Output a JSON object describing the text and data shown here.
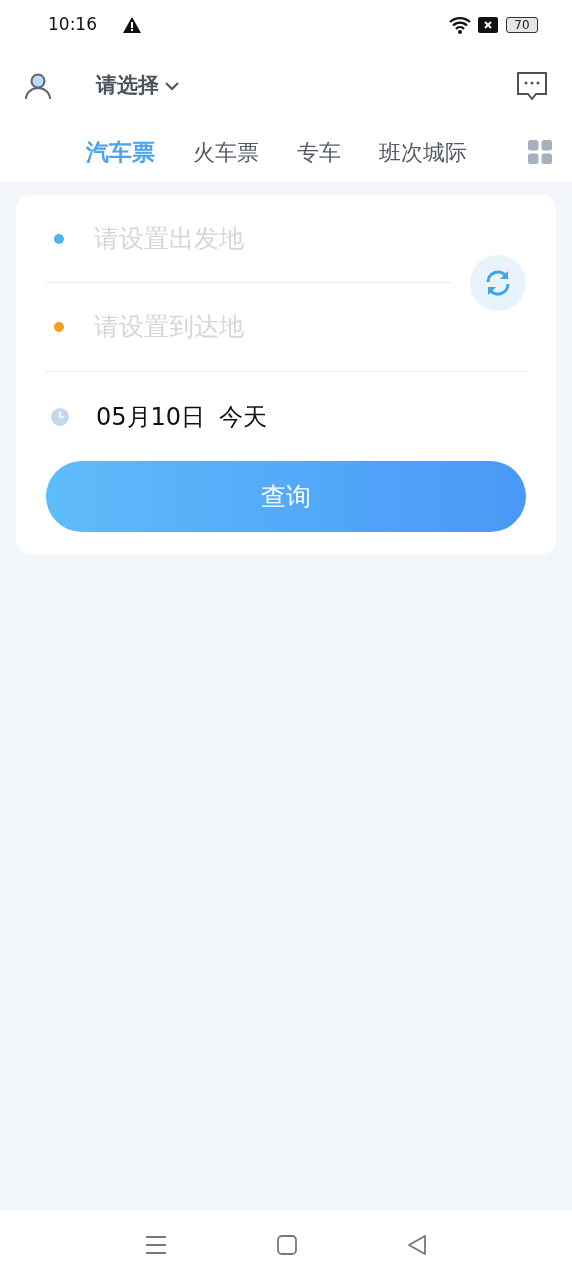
{
  "status_bar": {
    "time": "10:16",
    "battery": "70"
  },
  "header": {
    "city_picker": "请选择"
  },
  "tabs": [
    {
      "label": "汽车票",
      "selected": true
    },
    {
      "label": "火车票",
      "selected": false
    },
    {
      "label": "专车",
      "selected": false
    },
    {
      "label": "班次城际",
      "selected": false
    }
  ],
  "search": {
    "origin": {
      "placeholder": "请设置出发地",
      "color": "#4fb3f0"
    },
    "destination": {
      "placeholder": "请设置到达地",
      "color": "#f5a020"
    },
    "date": "05月10日",
    "day": "今天",
    "button": "查询"
  }
}
